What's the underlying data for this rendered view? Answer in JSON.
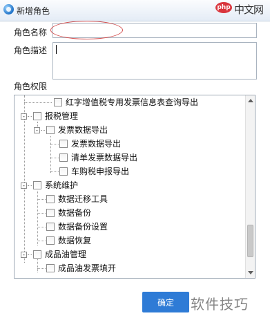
{
  "window": {
    "title": "新增角色"
  },
  "watermark_top": {
    "badge": "php",
    "text": "中文网"
  },
  "watermark_bottom": {
    "text": "软件技巧"
  },
  "form": {
    "name_label": "角色名称",
    "desc_label": "角色描述",
    "perm_label": "角色权限",
    "name_value": "",
    "desc_value": ""
  },
  "tree": {
    "nodes": [
      {
        "label": "红字增值税专用发票信息表查询导出",
        "toggle": ""
      },
      {
        "label": "报税管理",
        "toggle": "-"
      },
      {
        "label": "发票数据导出",
        "toggle": "-"
      },
      {
        "label": "发票数据导出",
        "toggle": ""
      },
      {
        "label": "清单发票数据导出",
        "toggle": ""
      },
      {
        "label": "车购税申报导出",
        "toggle": ""
      },
      {
        "label": "系统维护",
        "toggle": "-"
      },
      {
        "label": "数据迁移工具",
        "toggle": ""
      },
      {
        "label": "数据备份",
        "toggle": ""
      },
      {
        "label": "数据备份设置",
        "toggle": ""
      },
      {
        "label": "数据恢复",
        "toggle": ""
      },
      {
        "label": "成品油管理",
        "toggle": "-"
      },
      {
        "label": "成品油发票填开",
        "toggle": ""
      }
    ]
  },
  "buttons": {
    "ok": "确定"
  },
  "colors": {
    "accent": "#2e7bd6",
    "highlight": "#d24b4b"
  }
}
